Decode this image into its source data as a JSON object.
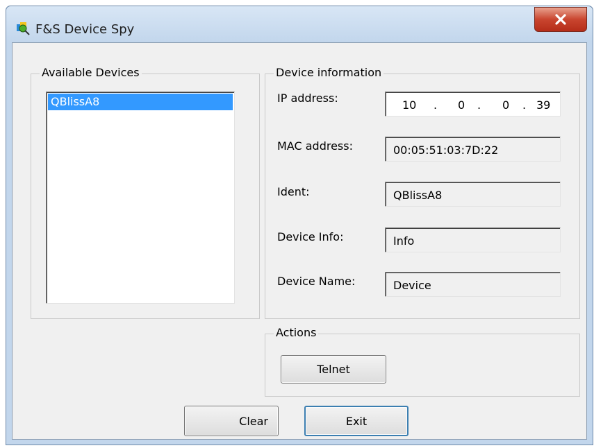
{
  "window": {
    "title": "F&S Device Spy",
    "app_icon": "device-spy-icon",
    "close_icon": "close-icon"
  },
  "available_devices": {
    "legend": "Available Devices",
    "items": [
      "QBlissA8"
    ],
    "selected": "QBlissA8"
  },
  "device_info": {
    "legend": "Device information",
    "ip_label": "IP address:",
    "ip_parts": [
      "10",
      ".",
      "0",
      ".",
      "0",
      ".",
      "39"
    ],
    "mac_label": "MAC address:",
    "mac_value": "00:05:51:03:7D:22",
    "ident_label": "Ident:",
    "ident_value": "QBlissA8",
    "info_label": "Device Info:",
    "info_value": "Info",
    "name_label": "Device Name:",
    "name_value": "Device"
  },
  "actions": {
    "legend": "Actions",
    "telnet_label": "Telnet"
  },
  "footer": {
    "clear_label": "Clear",
    "exit_label": "Exit"
  }
}
